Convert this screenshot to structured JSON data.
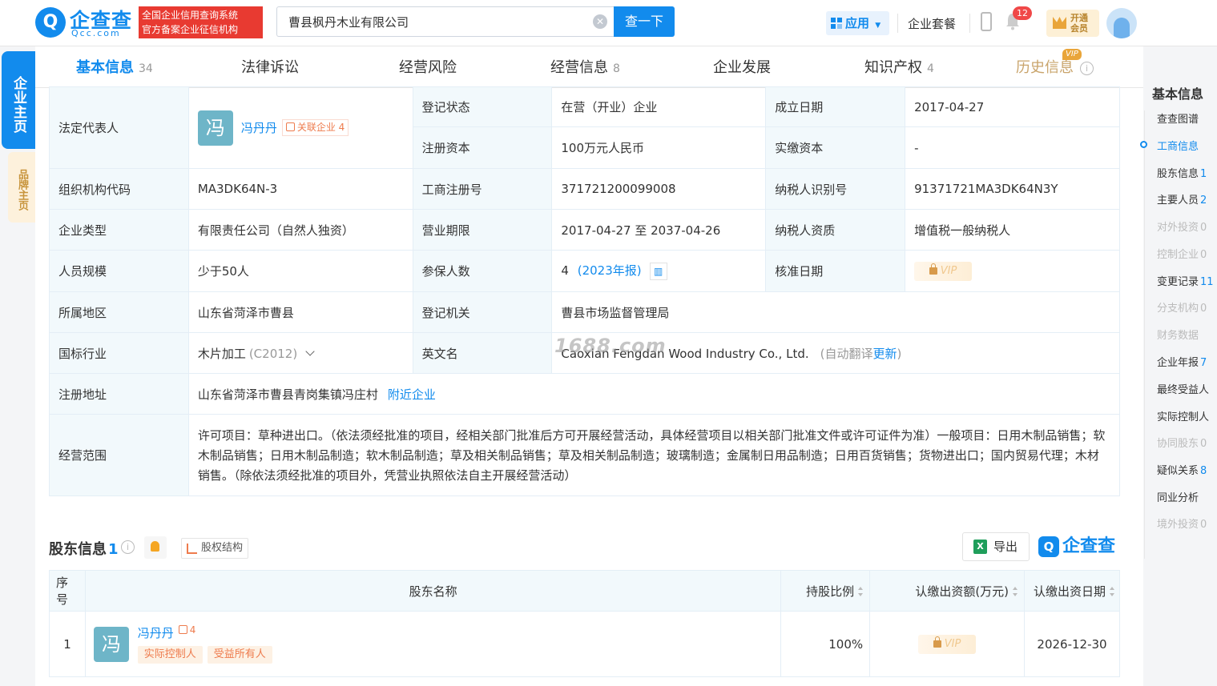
{
  "header": {
    "logo_mark": "Q",
    "logo_text": "企查查",
    "logo_sub": "Qcc.com",
    "badge_line1": "全国企业信用查询系统",
    "badge_line2": "官方备案企业征信机构",
    "search_value": "曹县枫丹木业有限公司",
    "search_button": "查一下",
    "apps_label": "应用",
    "suite_label": "企业套餐",
    "notify_count": "12",
    "vip_line1": "开通",
    "vip_line2": "会员"
  },
  "side_tabs": {
    "main": "企业主页",
    "brand": "品牌主页"
  },
  "tabs": [
    {
      "label": "基本信息",
      "count": "34"
    },
    {
      "label": "法律诉讼",
      "count": ""
    },
    {
      "label": "经营风险",
      "count": ""
    },
    {
      "label": "经营信息",
      "count": "8"
    },
    {
      "label": "企业发展",
      "count": ""
    },
    {
      "label": "知识产权",
      "count": "4"
    },
    {
      "label": "历史信息",
      "count": ""
    }
  ],
  "vip_tag": "VIP",
  "info": {
    "legal_rep_label": "法定代表人",
    "legal_rep_avatar": "冯",
    "legal_rep_name": "冯丹丹",
    "legal_rep_related": "关联企业",
    "legal_rep_related_count": "4",
    "reg_status_label": "登记状态",
    "reg_status": "在营（开业）企业",
    "found_date_label": "成立日期",
    "found_date": "2017-04-27",
    "reg_capital_label": "注册资本",
    "reg_capital": "100万元人民币",
    "paid_capital_label": "实缴资本",
    "paid_capital": "-",
    "org_code_label": "组织机构代码",
    "org_code": "MA3DK64N-3",
    "biz_reg_no_label": "工商注册号",
    "biz_reg_no": "371721200099008",
    "tax_id_label": "纳税人识别号",
    "tax_id": "91371721MA3DK64N3Y",
    "company_type_label": "企业类型",
    "company_type": "有限责任公司（自然人独资）",
    "biz_term_label": "营业期限",
    "biz_term": "2017-04-27 至 2037-04-26",
    "taxpayer_qual_label": "纳税人资质",
    "taxpayer_qual": "增值税一般纳税人",
    "staff_size_label": "人员规模",
    "staff_size": "少于50人",
    "insured_label": "参保人数",
    "insured_count": "4",
    "insured_year": "(2023年报)",
    "approve_date_label": "核准日期",
    "region_label": "所属地区",
    "region": "山东省菏泽市曹县",
    "reg_authority_label": "登记机关",
    "reg_authority": "曹县市场监督管理局",
    "industry_label": "国标行业",
    "industry": "木片加工",
    "industry_code": "(C2012)",
    "english_name_label": "英文名",
    "english_name": "Caoxian Fengdan Wood Industry Co., Ltd.",
    "auto_translate": "(自动翻译",
    "update_link": "更新",
    "close_paren": ")",
    "reg_address_label": "注册地址",
    "reg_address": "山东省菏泽市曹县青岗集镇冯庄村",
    "nearby_link": "附近企业",
    "biz_scope_label": "经营范围",
    "biz_scope": "许可项目：草种进出口。（依法须经批准的项目，经相关部门批准后方可开展经营活动，具体经营项目以相关部门批准文件或许可证件为准）一般项目：日用木制品销售；软木制品销售；日用木制品制造；软木制品制造；草及相关制品销售；草及相关制品制造；玻璃制造；金属制日用品制造；日用百货销售；货物进出口；国内贸易代理；木材销售。（除依法须经批准的项目外，凭营业执照依法自主开展经营活动）"
  },
  "vip_lock": "VIP",
  "watermark": "1688.com",
  "shareholders": {
    "title": "股东信息",
    "count": "1",
    "equity_btn": "股权结构",
    "export_btn": "导出",
    "export_icon": "X",
    "brand_logo": "企查查",
    "brand_mark": "Q",
    "columns": [
      "序号",
      "股东名称",
      "持股比例",
      "认缴出资额(万元)",
      "认缴出资日期"
    ],
    "rows": [
      {
        "index": "1",
        "avatar": "冯",
        "name": "冯丹丹",
        "related_count": "4",
        "tags": [
          "实际控制人",
          "受益所有人"
        ],
        "ratio": "100%",
        "date": "2026-12-30"
      }
    ]
  },
  "right_nav": {
    "title": "基本信息",
    "items": [
      {
        "label": "查查图谱",
        "count": ""
      },
      {
        "label": "工商信息",
        "count": ""
      },
      {
        "label": "股东信息",
        "count": "1"
      },
      {
        "label": "主要人员",
        "count": "2"
      },
      {
        "label": "对外投资",
        "count": "0"
      },
      {
        "label": "控制企业",
        "count": "0"
      },
      {
        "label": "变更记录",
        "count": "11"
      },
      {
        "label": "分支机构",
        "count": "0"
      },
      {
        "label": "财务数据",
        "count": ""
      },
      {
        "label": "企业年报",
        "count": "7"
      },
      {
        "label": "最终受益人",
        "count": ""
      },
      {
        "label": "实际控制人",
        "count": ""
      },
      {
        "label": "协同股东",
        "count": "0"
      },
      {
        "label": "疑似关系",
        "count": "8"
      },
      {
        "label": "同业分析",
        "count": ""
      },
      {
        "label": "境外投资",
        "count": "0"
      }
    ]
  }
}
